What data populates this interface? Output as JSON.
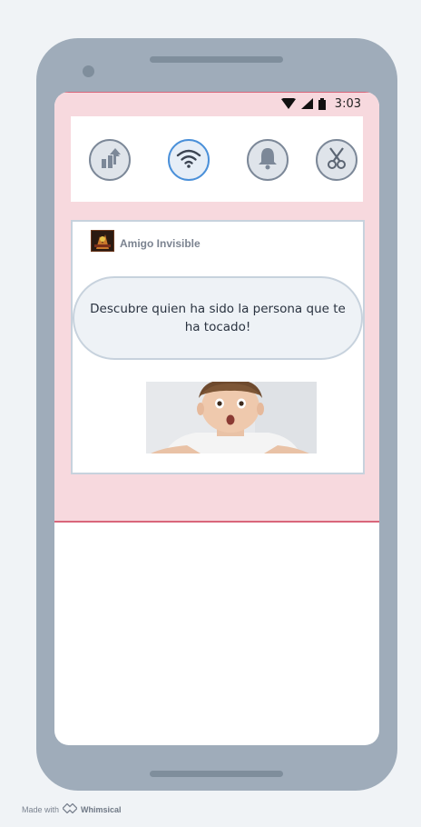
{
  "status_bar": {
    "time": "3:03",
    "icons": [
      "wifi-icon",
      "signal-icon",
      "battery-icon"
    ]
  },
  "quick_settings": [
    {
      "name": "upload",
      "icon": "upload-icon",
      "active": false
    },
    {
      "name": "wifi",
      "icon": "wifi-icon",
      "active": true
    },
    {
      "name": "notifications",
      "icon": "bell-icon",
      "active": false
    },
    {
      "name": "scissors",
      "icon": "scissors-icon",
      "active": false
    }
  ],
  "notification": {
    "app_name": "Amigo Invisible",
    "message": "Descubre quien ha sido la persona que te ha tocado!",
    "image": "surprised-child-photo"
  },
  "footer": {
    "made_with": "Made with",
    "brand": "Whimsical"
  },
  "colors": {
    "shade": "#f7d9de",
    "accent_line": "#d9667a",
    "device": "#9facba",
    "active_toggle": "#4a90d9"
  }
}
